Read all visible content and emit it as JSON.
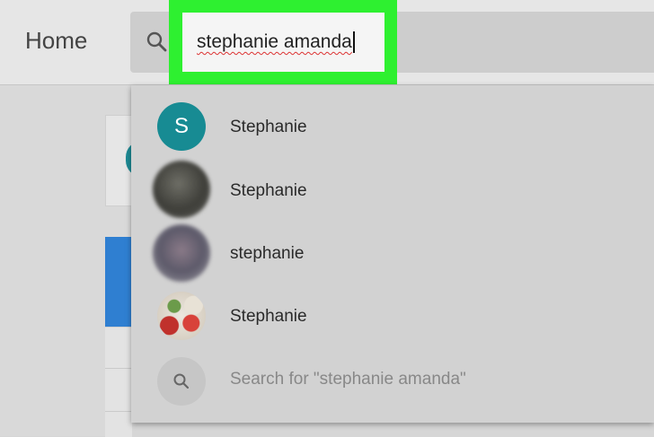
{
  "header": {
    "title": "Home",
    "search": {
      "value": "stephanie amanda"
    }
  },
  "dropdown": {
    "suggestions": [
      {
        "name": "Stephanie",
        "avatar_letter": "S"
      },
      {
        "name": "Stephanie"
      },
      {
        "name": "stephanie"
      },
      {
        "name": "Stephanie"
      }
    ],
    "search_for": "Search for \"stephanie amanda\""
  },
  "icons": {
    "search": "search-icon"
  },
  "colors": {
    "highlight": "#2ef030",
    "avatar_teal": "#178b93"
  }
}
